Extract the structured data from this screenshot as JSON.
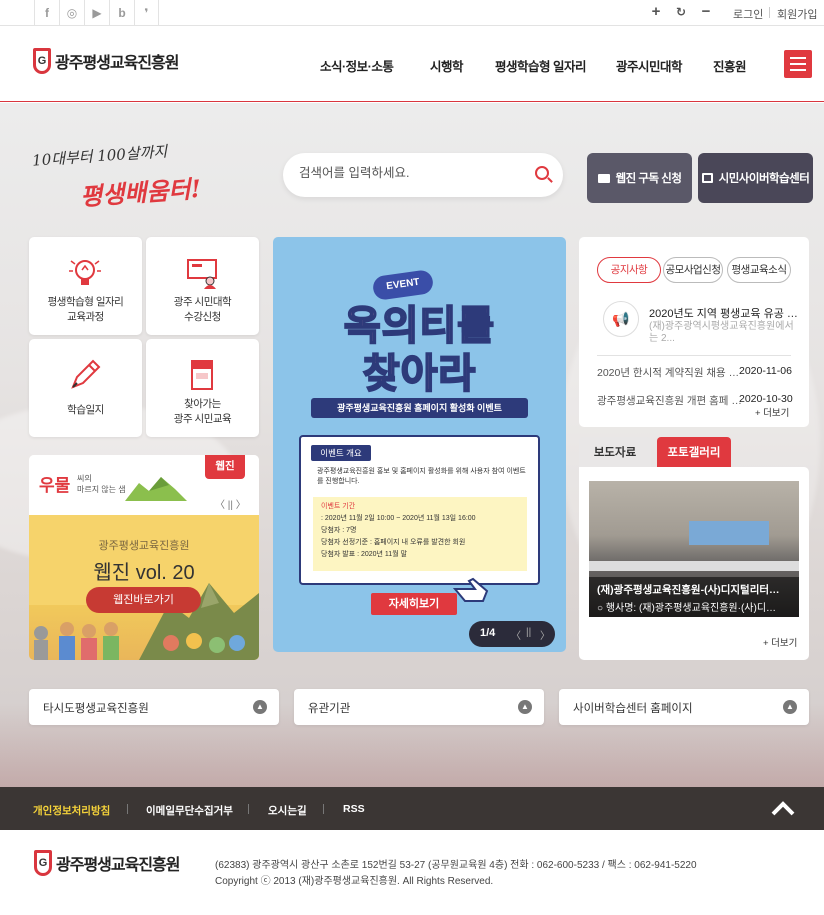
{
  "util": {
    "sns": [
      "facebook-icon",
      "instagram-icon",
      "youtube-icon",
      "blog-icon",
      "story-icon"
    ],
    "sns_glyphs": [
      "f",
      "◎",
      "▶",
      "b",
      "❜"
    ],
    "zoom_in": "+",
    "reset": "↻",
    "zoom_out": "−",
    "login": "로그인",
    "join": "회원가입"
  },
  "header": {
    "logo_text": "광주평생교육진흥원",
    "nav": [
      "소식·정보·소통",
      "시행학",
      "평생학습형 일자리",
      "광주시민대학",
      "진흥원"
    ]
  },
  "hero": {
    "slogan_1": "10대부터 100살까지",
    "slogan_2": "평생배움터!",
    "search_placeholder": "검색어를 입력하세요.",
    "btn_webzine_sub": "웹진 구독 신청",
    "btn_cyber": "시민사이버학습센터"
  },
  "tiles": [
    {
      "label_1": "평생학습형 일자리",
      "label_2": "교육과정"
    },
    {
      "label_1": "광주 시민대학",
      "label_2": "수강신청"
    },
    {
      "label_1": "학습일지",
      "label_2": ""
    },
    {
      "label_1": "찾아가는",
      "label_2": "광주 시민교육"
    }
  ],
  "webzine": {
    "badge": "웹진",
    "brand_1": "우물",
    "brand_2": "씨의",
    "brand_3": "마르지 않는 샘",
    "pager": "〈 || 〉",
    "org": "광주평생교육진흥원",
    "title": "웹진 vol. 20",
    "go_button": "웹진바로가기"
  },
  "event": {
    "tag": "EVENT",
    "title_1": "옥의티를",
    "title_2": "찾아라",
    "subtitle": "광주평생교육진흥원 홈페이지 활성화 이벤트",
    "box_title": "이벤트 개요",
    "desc": "광주평생교육진흥원 홍보 및 홈페이지 활성화를 위해 사용자 참여 이벤트를 진행합니다.",
    "items": [
      "이벤트 기간",
      ": 2020년 11월 2일 10:00 ~ 2020년 11월 13일 16:00",
      "당첨자 : 7명",
      "당첨자 선정기준 : 홈페이지 내 오류를 발견한 회원",
      "당첨자 발표 : 2020년 11월 말"
    ],
    "detail_button": "자세히보기",
    "counter": "1/4",
    "prev": "〈",
    "pause": "||",
    "next": "〉"
  },
  "notice": {
    "tabs": [
      "공지사항",
      "공모사업신청",
      "평생교육소식"
    ],
    "featured_title": "2020년도 지역 평생교육 유공 …",
    "featured_desc": "(재)광주광역시평생교육진흥원에서는 2...",
    "rows": [
      {
        "title": "2020년 한시적 계약직원 채용 …",
        "date": "2020-11-06"
      },
      {
        "title": "광주평생교육진흥원 개편 홈페 …",
        "date": "2020-10-30"
      }
    ],
    "more": "+ 더보기"
  },
  "gallery": {
    "tabs": [
      "보도자료",
      "포토갤러리"
    ],
    "caption_title": "(재)광주평생교육진흥원-(사)디지털리터…",
    "caption_sub": "○ 행사명: (재)광주평생교육진흥원·(사)디…",
    "more": "+ 더보기"
  },
  "links": [
    "타시도평생교육진흥원",
    "유관기관",
    "사이버학습센터 홈페이지"
  ],
  "footer": {
    "links": [
      "개인정보처리방침",
      "이메일무단수집거부",
      "오시는길",
      "RSS"
    ],
    "logo_text": "광주평생교육진흥원",
    "address": "(62383) 광주광역시 광산구 소촌로 152번길 53-27 (공무원교육원 4층) 전화 : 062-600-5233 / 팩스 : 062-941-5220",
    "copyright": "Copyright ⓒ 2013 (재)광주평생교육진흥원. All Rights Reserved."
  },
  "colors": {
    "brand": "#e0393f",
    "dark_button": "#53505f",
    "footer_bar": "#3b3634",
    "event_bg": "#8cc4e9"
  }
}
